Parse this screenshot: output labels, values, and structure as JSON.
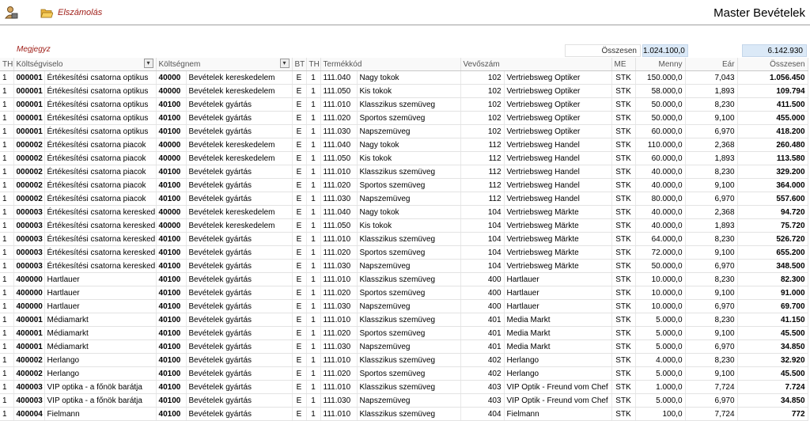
{
  "toolbar": {
    "menu_label": "Elszámolás",
    "title": "Master Bevételek"
  },
  "note_label": "Megjegyz",
  "summary": {
    "label": "Összesen",
    "menny_total": "1.024.100,0",
    "osszesen_total": "6.142.930"
  },
  "columns": [
    "TH",
    "Költségviselo",
    "Költségnem",
    "BT",
    "TH",
    "Termékkód",
    "Vevőszám",
    "ME",
    "Menny",
    "Eár",
    "Összesen"
  ],
  "rows": [
    [
      "1",
      "000001",
      "Értékesítési csatorna optikus",
      "40000",
      "Bevételek kereskedelem",
      "E",
      "1",
      "111.040",
      "Nagy tokok",
      "102",
      "Vertriebsweg Optiker",
      "STK",
      "150.000,0",
      "7,043",
      "1.056.450"
    ],
    [
      "1",
      "000001",
      "Értékesítési csatorna optikus",
      "40000",
      "Bevételek kereskedelem",
      "E",
      "1",
      "111.050",
      "Kis tokok",
      "102",
      "Vertriebsweg Optiker",
      "STK",
      "58.000,0",
      "1,893",
      "109.794"
    ],
    [
      "1",
      "000001",
      "Értékesítési csatorna optikus",
      "40100",
      "Bevételek gyártás",
      "E",
      "1",
      "111.010",
      "Klasszikus szemüveg",
      "102",
      "Vertriebsweg Optiker",
      "STK",
      "50.000,0",
      "8,230",
      "411.500"
    ],
    [
      "1",
      "000001",
      "Értékesítési csatorna optikus",
      "40100",
      "Bevételek gyártás",
      "E",
      "1",
      "111.020",
      "Sportos szemüveg",
      "102",
      "Vertriebsweg Optiker",
      "STK",
      "50.000,0",
      "9,100",
      "455.000"
    ],
    [
      "1",
      "000001",
      "Értékesítési csatorna optikus",
      "40100",
      "Bevételek gyártás",
      "E",
      "1",
      "111.030",
      "Napszemüveg",
      "102",
      "Vertriebsweg Optiker",
      "STK",
      "60.000,0",
      "6,970",
      "418.200"
    ],
    [
      "1",
      "000002",
      "Értékesítési csatorna piacok",
      "40000",
      "Bevételek kereskedelem",
      "E",
      "1",
      "111.040",
      "Nagy tokok",
      "112",
      "Vertriebsweg Handel",
      "STK",
      "110.000,0",
      "2,368",
      "260.480"
    ],
    [
      "1",
      "000002",
      "Értékesítési csatorna piacok",
      "40000",
      "Bevételek kereskedelem",
      "E",
      "1",
      "111.050",
      "Kis tokok",
      "112",
      "Vertriebsweg Handel",
      "STK",
      "60.000,0",
      "1,893",
      "113.580"
    ],
    [
      "1",
      "000002",
      "Értékesítési csatorna piacok",
      "40100",
      "Bevételek gyártás",
      "E",
      "1",
      "111.010",
      "Klasszikus szemüveg",
      "112",
      "Vertriebsweg Handel",
      "STK",
      "40.000,0",
      "8,230",
      "329.200"
    ],
    [
      "1",
      "000002",
      "Értékesítési csatorna piacok",
      "40100",
      "Bevételek gyártás",
      "E",
      "1",
      "111.020",
      "Sportos szemüveg",
      "112",
      "Vertriebsweg Handel",
      "STK",
      "40.000,0",
      "9,100",
      "364.000"
    ],
    [
      "1",
      "000002",
      "Értékesítési csatorna piacok",
      "40100",
      "Bevételek gyártás",
      "E",
      "1",
      "111.030",
      "Napszemüveg",
      "112",
      "Vertriebsweg Handel",
      "STK",
      "80.000,0",
      "6,970",
      "557.600"
    ],
    [
      "1",
      "000003",
      "Értékesítési csatorna keresked",
      "40000",
      "Bevételek kereskedelem",
      "E",
      "1",
      "111.040",
      "Nagy tokok",
      "104",
      "Vertriebsweg Märkte",
      "STK",
      "40.000,0",
      "2,368",
      "94.720"
    ],
    [
      "1",
      "000003",
      "Értékesítési csatorna keresked",
      "40000",
      "Bevételek kereskedelem",
      "E",
      "1",
      "111.050",
      "Kis tokok",
      "104",
      "Vertriebsweg Märkte",
      "STK",
      "40.000,0",
      "1,893",
      "75.720"
    ],
    [
      "1",
      "000003",
      "Értékesítési csatorna keresked",
      "40100",
      "Bevételek gyártás",
      "E",
      "1",
      "111.010",
      "Klasszikus szemüveg",
      "104",
      "Vertriebsweg Märkte",
      "STK",
      "64.000,0",
      "8,230",
      "526.720"
    ],
    [
      "1",
      "000003",
      "Értékesítési csatorna keresked",
      "40100",
      "Bevételek gyártás",
      "E",
      "1",
      "111.020",
      "Sportos szemüveg",
      "104",
      "Vertriebsweg Märkte",
      "STK",
      "72.000,0",
      "9,100",
      "655.200"
    ],
    [
      "1",
      "000003",
      "Értékesítési csatorna keresked",
      "40100",
      "Bevételek gyártás",
      "E",
      "1",
      "111.030",
      "Napszemüveg",
      "104",
      "Vertriebsweg Märkte",
      "STK",
      "50.000,0",
      "6,970",
      "348.500"
    ],
    [
      "1",
      "400000",
      "Hartlauer",
      "40100",
      "Bevételek gyártás",
      "E",
      "1",
      "111.010",
      "Klasszikus szemüveg",
      "400",
      "Hartlauer",
      "STK",
      "10.000,0",
      "8,230",
      "82.300"
    ],
    [
      "1",
      "400000",
      "Hartlauer",
      "40100",
      "Bevételek gyártás",
      "E",
      "1",
      "111.020",
      "Sportos szemüveg",
      "400",
      "Hartlauer",
      "STK",
      "10.000,0",
      "9,100",
      "91.000"
    ],
    [
      "1",
      "400000",
      "Hartlauer",
      "40100",
      "Bevételek gyártás",
      "E",
      "1",
      "111.030",
      "Napszemüveg",
      "400",
      "Hartlauer",
      "STK",
      "10.000,0",
      "6,970",
      "69.700"
    ],
    [
      "1",
      "400001",
      "Médiamarkt",
      "40100",
      "Bevételek gyártás",
      "E",
      "1",
      "111.010",
      "Klasszikus szemüveg",
      "401",
      "Media Markt",
      "STK",
      "5.000,0",
      "8,230",
      "41.150"
    ],
    [
      "1",
      "400001",
      "Médiamarkt",
      "40100",
      "Bevételek gyártás",
      "E",
      "1",
      "111.020",
      "Sportos szemüveg",
      "401",
      "Media Markt",
      "STK",
      "5.000,0",
      "9,100",
      "45.500"
    ],
    [
      "1",
      "400001",
      "Médiamarkt",
      "40100",
      "Bevételek gyártás",
      "E",
      "1",
      "111.030",
      "Napszemüveg",
      "401",
      "Media Markt",
      "STK",
      "5.000,0",
      "6,970",
      "34.850"
    ],
    [
      "1",
      "400002",
      "Herlango",
      "40100",
      "Bevételek gyártás",
      "E",
      "1",
      "111.010",
      "Klasszikus szemüveg",
      "402",
      "Herlango",
      "STK",
      "4.000,0",
      "8,230",
      "32.920"
    ],
    [
      "1",
      "400002",
      "Herlango",
      "40100",
      "Bevételek gyártás",
      "E",
      "1",
      "111.020",
      "Sportos szemüveg",
      "402",
      "Herlango",
      "STK",
      "5.000,0",
      "9,100",
      "45.500"
    ],
    [
      "1",
      "400003",
      "VIP optika - a főnök barátja",
      "40100",
      "Bevételek gyártás",
      "E",
      "1",
      "111.010",
      "Klasszikus szemüveg",
      "403",
      "VIP Optik - Freund vom Chef",
      "STK",
      "1.000,0",
      "7,724",
      "7.724"
    ],
    [
      "1",
      "400003",
      "VIP optika - a főnök barátja",
      "40100",
      "Bevételek gyártás",
      "E",
      "1",
      "111.030",
      "Napszemüveg",
      "403",
      "VIP Optik - Freund vom Chef",
      "STK",
      "5.000,0",
      "6,970",
      "34.850"
    ],
    [
      "1",
      "400004",
      "Fielmann",
      "40100",
      "Bevételek gyártás",
      "E",
      "1",
      "111.010",
      "Klasszikus szemüveg",
      "404",
      "Fielmann",
      "STK",
      "100,0",
      "7,724",
      "772"
    ]
  ]
}
